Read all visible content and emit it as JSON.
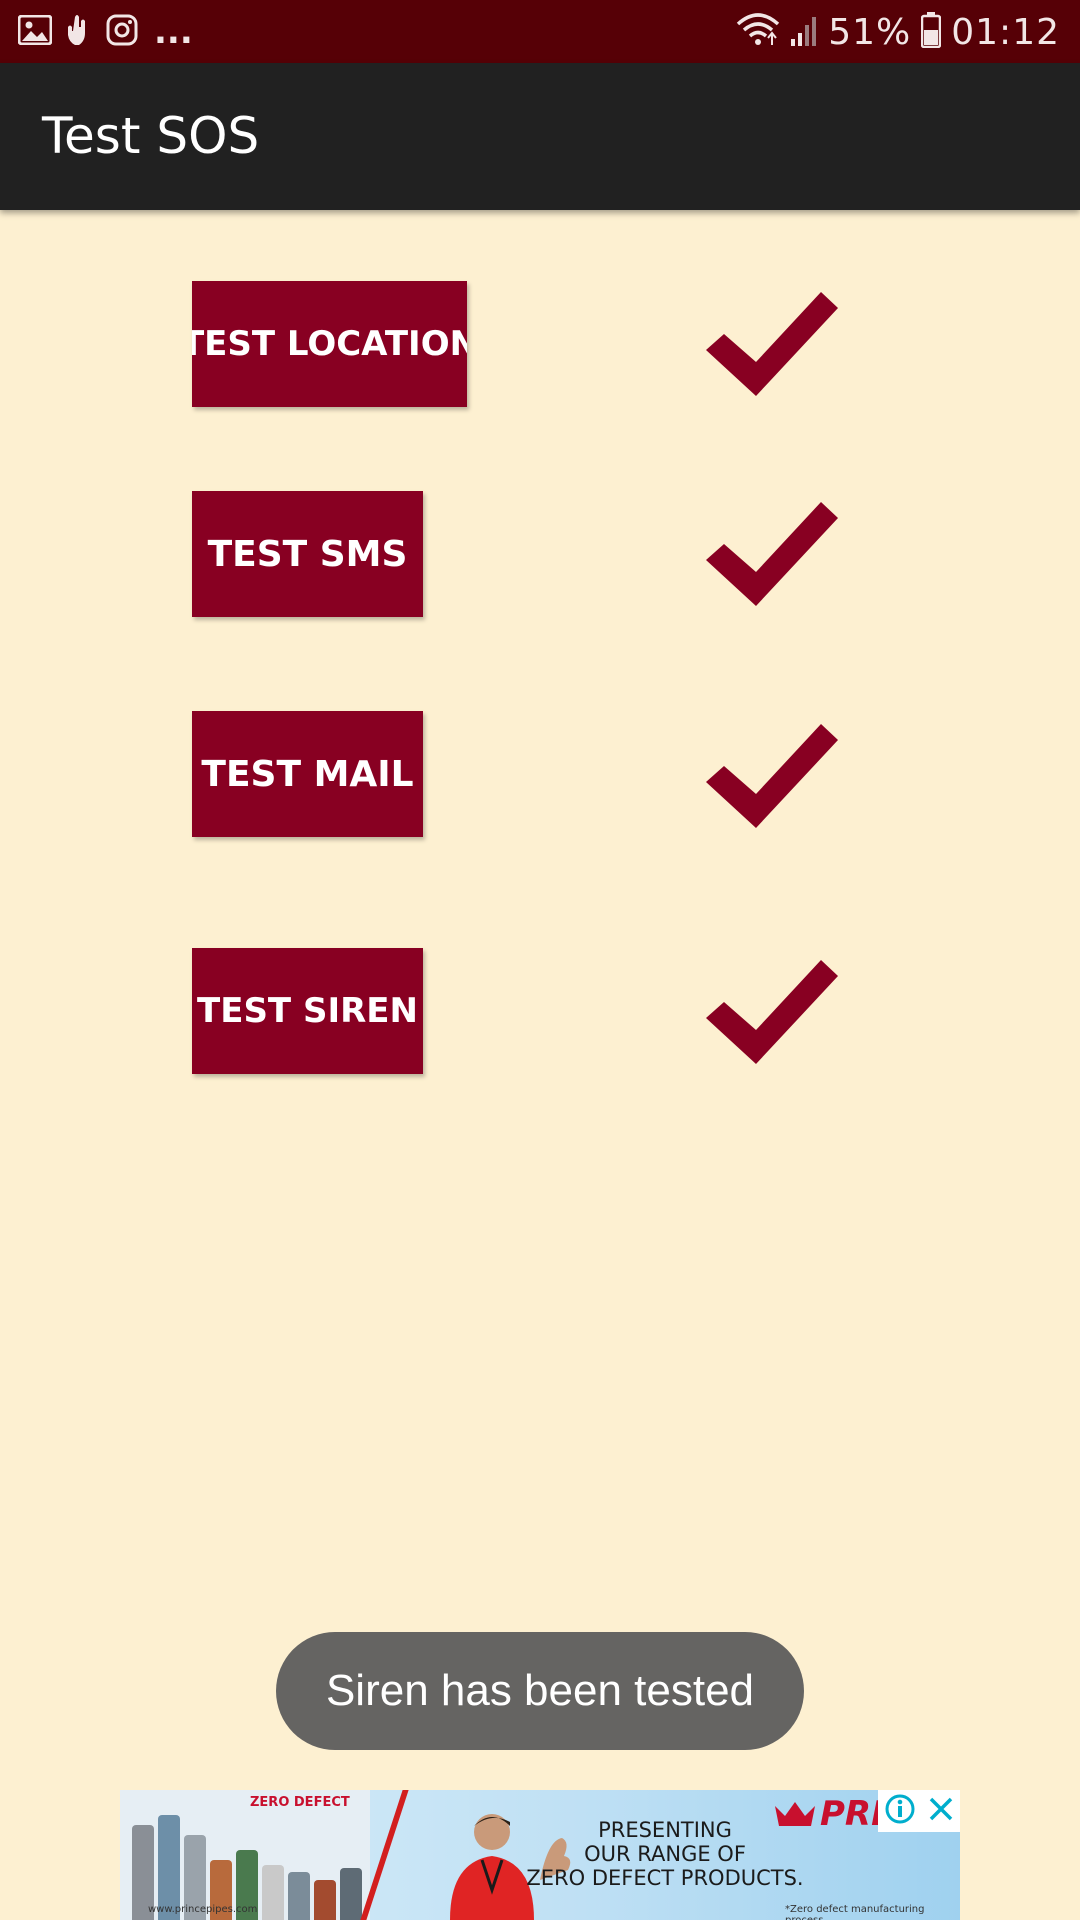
{
  "status_bar": {
    "left_icons": [
      "image-icon",
      "hand-icon",
      "instagram-icon"
    ],
    "more": "...",
    "battery_percent": "51%",
    "time": "01:12"
  },
  "app_bar": {
    "title": "Test SOS"
  },
  "tests": [
    {
      "label": "TEST LOCATION",
      "status": "passed"
    },
    {
      "label": "TEST SMS",
      "status": "passed"
    },
    {
      "label": "TEST MAIL",
      "status": "passed"
    },
    {
      "label": "TEST SIREN",
      "status": "passed"
    }
  ],
  "toast": {
    "message": "Siren has been tested"
  },
  "ad": {
    "brand": "PRI",
    "zero_defect_logo": "ZERO DEFECT",
    "headline_1": "PRESENTING",
    "headline_2": "OUR RANGE OF",
    "headline_3": "ZERO DEFECT PRODUCTS.",
    "url": "www.princepipes.com",
    "footnote": "*Zero defect manufacturing process"
  },
  "colors": {
    "status_bar": "#560006",
    "app_bar": "#212121",
    "background": "#fdf0d1",
    "button": "#880022",
    "check": "#880022",
    "toast": "#656462"
  }
}
